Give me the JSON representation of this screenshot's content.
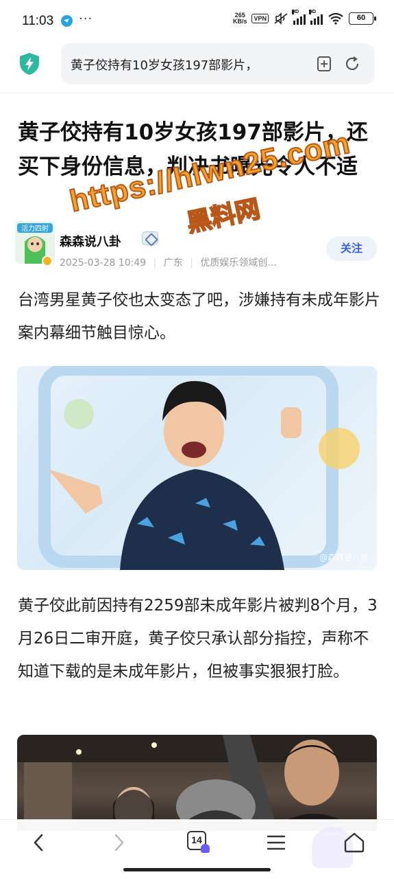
{
  "status_bar": {
    "time": "11:03",
    "dots": "···",
    "speed_value": "265",
    "speed_unit": "KB/s",
    "vpn": "VPN",
    "hd": "HD",
    "battery": "60"
  },
  "address_bar": {
    "query": "黄子佼持有10岁女孩197部影片，",
    "shield_icon": "shield-bolt-icon",
    "bookmark_icon": "add-bookmark-icon",
    "reload_icon": "reload-icon"
  },
  "article": {
    "title": "黄子佼持有10岁女孩197部影片，还买下身份信息，判决书曝光令人不适",
    "author": "森森说八卦",
    "date": "2025-03-28 10:49",
    "location": "广东",
    "tag": "优质娱乐领域创...",
    "follow_label": "关注",
    "avatar_label": "活力四射",
    "paragraph1": "台湾男星黄子佼也太变态了吧，涉嫌持有未成年影片案内幕细节触目惊心。",
    "image1_credit": "@森森说八卦",
    "paragraph2": "黄子佼此前因持有2259部未成年影片被判8个月，3月26日二审开庭，黄子佼只承认部分指控，声称不知道下载的是未成年影片，但被事实狠狠打脸。"
  },
  "watermark": {
    "url": "https://hlwn25.com",
    "name": "黑料网"
  },
  "bottom_nav": {
    "back_icon": "back-arrow-icon",
    "forward_icon": "forward-arrow-icon",
    "tab_count": "14",
    "menu_icon": "menu-icon",
    "home_icon": "home-icon"
  },
  "colors": {
    "accent": "#3a63d8",
    "follow_bg": "#eef2fb",
    "watermark": "#f2a42c",
    "shield": "#2fb8a0"
  }
}
